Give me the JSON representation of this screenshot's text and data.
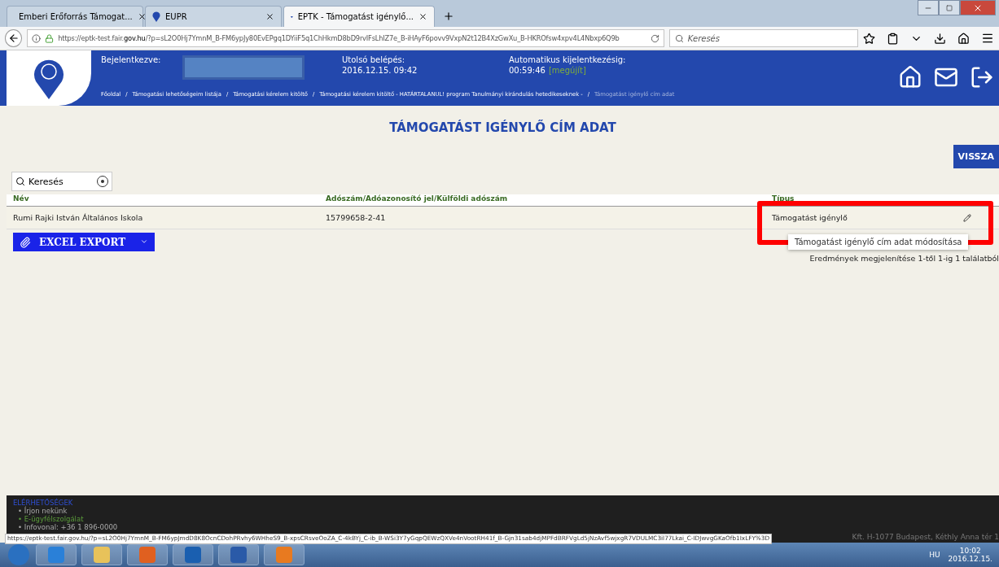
{
  "browser": {
    "tabs": [
      {
        "label": "Emberi Erőforrás Támogat...",
        "selected": false,
        "kind": "flag"
      },
      {
        "label": "EUPR",
        "selected": false,
        "kind": "pin"
      },
      {
        "label": "EPTK - Támogatást igénylő...",
        "selected": true,
        "kind": "gem"
      }
    ],
    "url_prefix": "https://eptk-test.fair.",
    "url_domain": "gov.hu",
    "url_rest": "/?p=sL2O0Hj7YmnM_B-FM6ypJy80EvEPgq1DYiiF5q1ChHkmD8bD9rvIFsLhIZ7e_B-iHAyF6povv9VxpN2t12B4XzGwXu_B-HKROfsw4xpv4L4Nbxp6Q9b",
    "search_placeholder": "Keresés"
  },
  "header": {
    "logged_in_label": "Bejelentkezve:",
    "last_login_label": "Utolsó belépés:",
    "last_login": "2016.12.15. 09:42",
    "auto_logout_label": "Automatikus kijelentkezésig:",
    "auto_logout": "00:59:46",
    "renew": "[megújít]",
    "breadcrumb_separator": "/",
    "breadcrumbs": [
      "Főoldal",
      "Támogatási lehetőségeim listája",
      "Támogatási kérelem kitöltő",
      "Támogatási kérelem kitöltő - HATÁRTALANUL! program Tanulmányi kirándulás hetedikeseknek -",
      "Támogatást igénylő cím adat"
    ]
  },
  "page": {
    "title": "TÁMOGATÁST IGÉNYLŐ CÍM ADAT",
    "back_button": "VISSZA",
    "search_button": "Keresés",
    "columns": [
      "Név",
      "Adószám/Adóazonosító jel/Külföldi adószám",
      "Típus"
    ],
    "rows": [
      {
        "cells": [
          "Rumi Rajki István Általános Iskola",
          "15799658-2-41",
          "Támogatást igénylő"
        ]
      }
    ],
    "export_button": "EXCEL EXPORT",
    "popup_item": "Támogatást igénylő cím adat módosítása",
    "results": "Eredmények megjelenítése 1-től 1-ig 1 találatból"
  },
  "footer": {
    "heading": "ELÉRHETŐSÉGEK",
    "bullet": "•",
    "links": [
      "Írjon nekünk",
      "E-ügyfélszolgálat",
      "Infovonal: +36 1 896-0000"
    ],
    "copyright": "Kft. H-1077 Budapest, Kéthly Anna tér 1"
  },
  "status_url": "https://eptk-test.fair.gov.hu/?p=sL2O0Hj7YmnM_B-FM6ypJmdD8K8OcnCDohPRvhy6WHheS9_B-xpsCRsveOoZA_C-4kBYj_C-ib_B-WSi3Y7yGqpQEWzQXVe4nVootRH41f_B-Gjn31sab4djMPFdBRFVgLd5jNzAvf5wjxgR7VDULMC3il77Lkai_C-IDJwvgGKaOfb1IxLFY%3D",
  "taskbar": {
    "lang": "HU",
    "time": "10:02",
    "date": "2016.12.15."
  }
}
